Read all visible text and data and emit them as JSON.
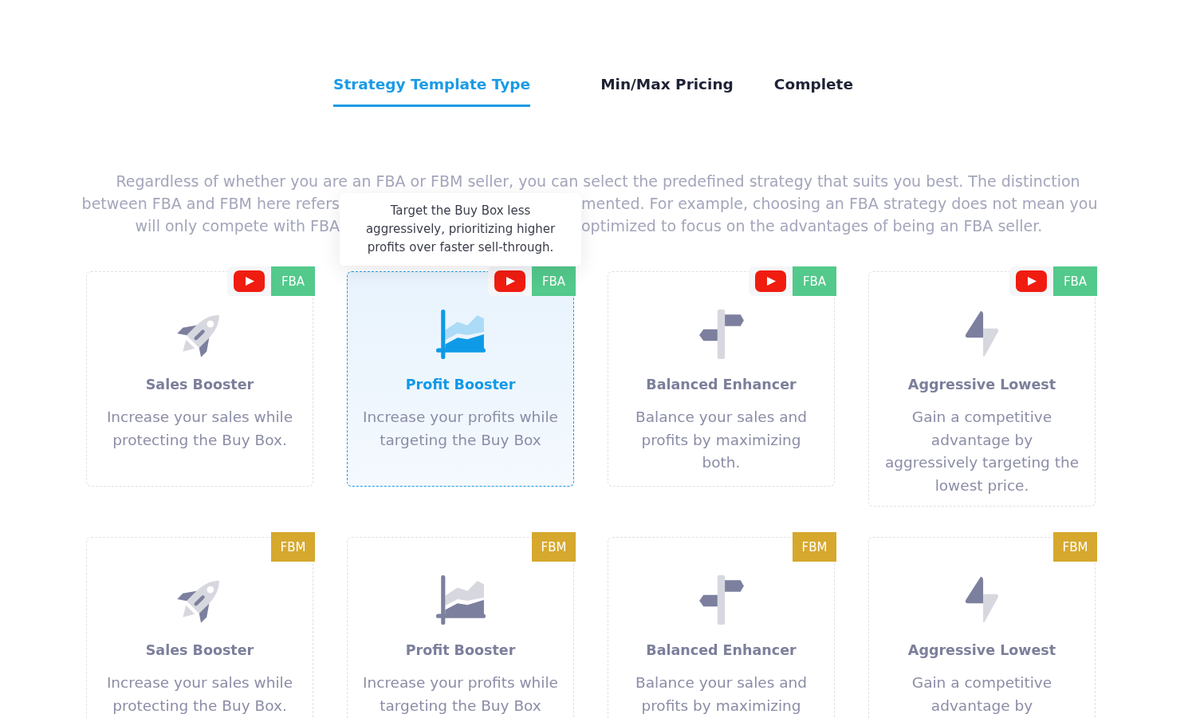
{
  "tabs": [
    {
      "label": "Strategy Template Type",
      "selected": true
    },
    {
      "label": "Min/Max Pricing",
      "selected": false
    },
    {
      "label": "Complete",
      "selected": false
    }
  ],
  "intro": {
    "lines": [
      {
        "segments": [
          "Regardless of whether you are an FBA or FBM seller, you can select the predefined strategy that suits you best. The distinction"
        ]
      },
      {
        "segments": [
          "between FBA and FBM here refers",
          "mented. For example, choosing an FBA strategy does not mean you"
        ]
      },
      {
        "segments": [
          "will only compete with FBA",
          "optimized to focus on the advantages of being an FBA seller."
        ]
      }
    ]
  },
  "cards": [
    {
      "kind": "sales",
      "title": "Sales Booster",
      "description": "Increase your sales while protecting the Buy Box.",
      "badge": {
        "label": "FBA",
        "color": "#53c98b"
      },
      "video": true,
      "selected": false
    },
    {
      "kind": "profit",
      "title": "Profit Booster",
      "description": "Increase your profits while targeting the Buy Box",
      "badge": {
        "label": "FBA",
        "color": "#53c98b"
      },
      "video": true,
      "selected": true,
      "tooltip": "Target the Buy Box less aggressively, prioritizing higher profits over faster sell-through."
    },
    {
      "kind": "balanced",
      "title": "Balanced Enhancer",
      "description": "Balance your sales and profits by maximizing both.",
      "badge": {
        "label": "FBA",
        "color": "#53c98b"
      },
      "video": true,
      "selected": false
    },
    {
      "kind": "aggressive",
      "title": "Aggressive Lowest",
      "description": "Gain a competitive advantage by aggressively targeting the lowest price.",
      "badge": {
        "label": "FBA",
        "color": "#53c98b"
      },
      "video": true,
      "selected": false
    },
    {
      "kind": "sales",
      "title": "Sales Booster",
      "description": "Increase your sales while protecting the Buy Box.",
      "badge": {
        "label": "FBM",
        "color": "#d6a82e"
      },
      "video": false,
      "selected": false
    },
    {
      "kind": "profit",
      "title": "Profit Booster",
      "description": "Increase your profits while targeting the Buy Box",
      "badge": {
        "label": "FBM",
        "color": "#d6a82e"
      },
      "video": false,
      "selected": false
    },
    {
      "kind": "balanced",
      "title": "Balanced Enhancer",
      "description": "Balance your sales and profits by maximizing",
      "badge": {
        "label": "FBM",
        "color": "#d6a82e"
      },
      "video": false,
      "selected": false
    },
    {
      "kind": "aggressive",
      "title": "Aggressive Lowest",
      "description": "Gain a competitive advantage by",
      "badge": {
        "label": "FBM",
        "color": "#d6a82e"
      },
      "video": false,
      "selected": false
    }
  ]
}
